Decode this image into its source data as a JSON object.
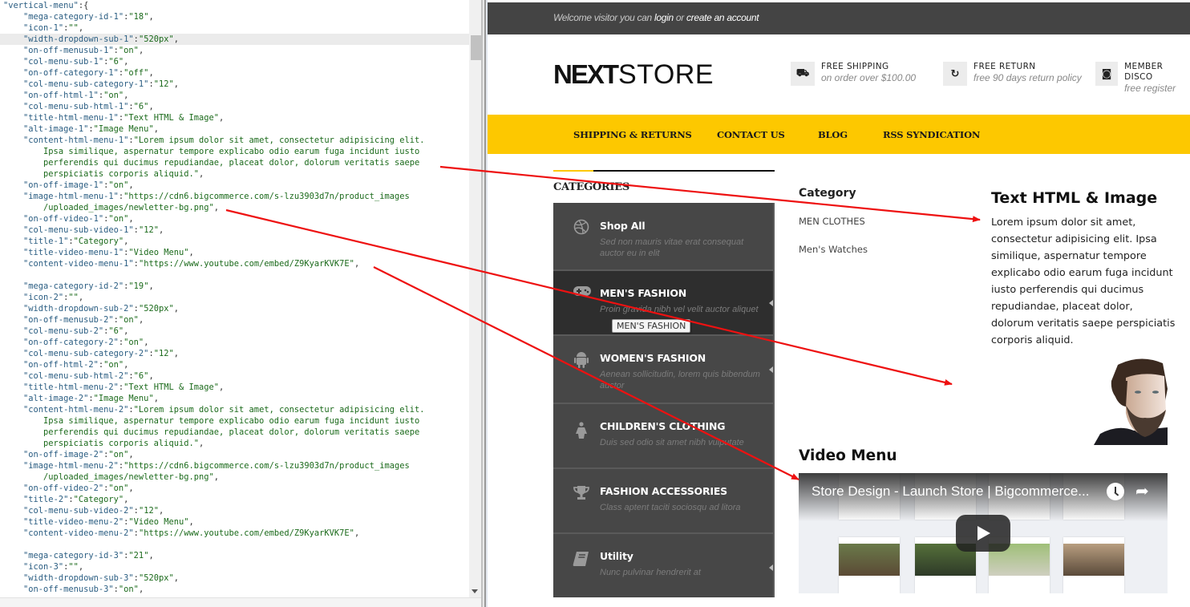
{
  "editor": {
    "lines": [
      {
        "indent": 0,
        "key": "vertical-menu",
        "value": null,
        "suffix": ":{"
      },
      {
        "indent": 1,
        "key": "mega-category-id-1",
        "value": "18",
        "suffix": ","
      },
      {
        "indent": 1,
        "key": "icon-1",
        "value": "",
        "suffix": ","
      },
      {
        "indent": 1,
        "key": "width-dropdown-sub-1",
        "value": "520px",
        "suffix": ",",
        "highlighted": true
      },
      {
        "indent": 1,
        "key": "on-off-menusub-1",
        "value": "on",
        "suffix": ","
      },
      {
        "indent": 1,
        "key": "col-menu-sub-1",
        "value": "6",
        "suffix": ","
      },
      {
        "indent": 1,
        "key": "on-off-category-1",
        "value": "off",
        "suffix": ","
      },
      {
        "indent": 1,
        "key": "col-menu-sub-category-1",
        "value": "12",
        "suffix": ","
      },
      {
        "indent": 1,
        "key": "on-off-html-1",
        "value": "on",
        "suffix": ","
      },
      {
        "indent": 1,
        "key": "col-menu-sub-html-1",
        "value": "6",
        "suffix": ","
      },
      {
        "indent": 1,
        "key": "title-html-menu-1",
        "value": "Text HTML & Image",
        "suffix": ","
      },
      {
        "indent": 1,
        "key": "alt-image-1",
        "value": "Image Menu",
        "suffix": ","
      },
      {
        "indent": 1,
        "key": "content-html-menu-1",
        "value_open": "Lorem ipsum dolor sit amet, consectetur adipisicing elit."
      },
      {
        "indent": 2,
        "cont": "Ipsa similique, aspernatur tempore explicabo odio earum fuga incidunt iusto"
      },
      {
        "indent": 2,
        "cont": "perferendis qui ducimus repudiandae, placeat dolor, dolorum veritatis saepe"
      },
      {
        "indent": 2,
        "cont_close": "perspiciatis corporis aliquid.",
        "suffix": ","
      },
      {
        "indent": 1,
        "key": "on-off-image-1",
        "value": "on",
        "suffix": ","
      },
      {
        "indent": 1,
        "key": "image-html-menu-1",
        "value_open": "https://cdn6.bigcommerce.com/s-lzu3903d7n/product_images"
      },
      {
        "indent": 2,
        "cont_close": "/uploaded_images/newletter-bg.png",
        "suffix": ","
      },
      {
        "indent": 1,
        "key": "on-off-video-1",
        "value": "on",
        "suffix": ","
      },
      {
        "indent": 1,
        "key": "col-menu-sub-video-1",
        "value": "12",
        "suffix": ","
      },
      {
        "indent": 1,
        "key": "title-1",
        "value": "Category",
        "suffix": ","
      },
      {
        "indent": 1,
        "key": "title-video-menu-1",
        "value": "Video Menu",
        "suffix": ","
      },
      {
        "indent": 1,
        "key": "content-video-menu-1",
        "value": "https://www.youtube.com/embed/Z9KyarKVK7E",
        "suffix": ","
      },
      {
        "indent": 0,
        "blank": true
      },
      {
        "indent": 1,
        "key": "mega-category-id-2",
        "value": "19",
        "suffix": ","
      },
      {
        "indent": 1,
        "key": "icon-2",
        "value": "",
        "suffix": ","
      },
      {
        "indent": 1,
        "key": "width-dropdown-sub-2",
        "value": "520px",
        "suffix": ","
      },
      {
        "indent": 1,
        "key": "on-off-menusub-2",
        "value": "on",
        "suffix": ","
      },
      {
        "indent": 1,
        "key": "col-menu-sub-2",
        "value": "6",
        "suffix": ","
      },
      {
        "indent": 1,
        "key": "on-off-category-2",
        "value": "on",
        "suffix": ","
      },
      {
        "indent": 1,
        "key": "col-menu-sub-category-2",
        "value": "12",
        "suffix": ","
      },
      {
        "indent": 1,
        "key": "on-off-html-2",
        "value": "on",
        "suffix": ","
      },
      {
        "indent": 1,
        "key": "col-menu-sub-html-2",
        "value": "6",
        "suffix": ","
      },
      {
        "indent": 1,
        "key": "title-html-menu-2",
        "value": "Text HTML & Image",
        "suffix": ","
      },
      {
        "indent": 1,
        "key": "alt-image-2",
        "value": "Image Menu",
        "suffix": ","
      },
      {
        "indent": 1,
        "key": "content-html-menu-2",
        "value_open": "Lorem ipsum dolor sit amet, consectetur adipisicing elit."
      },
      {
        "indent": 2,
        "cont": "Ipsa similique, aspernatur tempore explicabo odio earum fuga incidunt iusto"
      },
      {
        "indent": 2,
        "cont": "perferendis qui ducimus repudiandae, placeat dolor, dolorum veritatis saepe"
      },
      {
        "indent": 2,
        "cont_close": "perspiciatis corporis aliquid.",
        "suffix": ","
      },
      {
        "indent": 1,
        "key": "on-off-image-2",
        "value": "on",
        "suffix": ","
      },
      {
        "indent": 1,
        "key": "image-html-menu-2",
        "value_open": "https://cdn6.bigcommerce.com/s-lzu3903d7n/product_images"
      },
      {
        "indent": 2,
        "cont_close": "/uploaded_images/newletter-bg.png",
        "suffix": ","
      },
      {
        "indent": 1,
        "key": "on-off-video-2",
        "value": "on",
        "suffix": ","
      },
      {
        "indent": 1,
        "key": "title-2",
        "value": "Category",
        "suffix": ","
      },
      {
        "indent": 1,
        "key": "col-menu-sub-video-2",
        "value": "12",
        "suffix": ","
      },
      {
        "indent": 1,
        "key": "title-video-menu-2",
        "value": "Video Menu",
        "suffix": ","
      },
      {
        "indent": 1,
        "key": "content-video-menu-2",
        "value": "https://www.youtube.com/embed/Z9KyarKVK7E",
        "suffix": ","
      },
      {
        "indent": 0,
        "blank": true
      },
      {
        "indent": 1,
        "key": "mega-category-id-3",
        "value": "21",
        "suffix": ","
      },
      {
        "indent": 1,
        "key": "icon-3",
        "value": "",
        "suffix": ","
      },
      {
        "indent": 1,
        "key": "width-dropdown-sub-3",
        "value": "520px",
        "suffix": ","
      },
      {
        "indent": 1,
        "key": "on-off-menusub-3",
        "value": "on",
        "suffix": ","
      }
    ]
  },
  "site": {
    "topbar": {
      "welcome_prefix": "Welcome visitor you can ",
      "login_label": "login",
      "or_label": " or ",
      "create_account_label": "create an account"
    },
    "logo": {
      "part1": "NE",
      "part2": "X",
      "part3": "T",
      "part4": "STORE",
      "accent_color": "#f9c400"
    },
    "features": [
      {
        "icon": "truck-icon",
        "glyph": "⛟",
        "title": "FREE SHIPPING",
        "subtitle": "on order over $100.00"
      },
      {
        "icon": "refresh-icon",
        "glyph": "↻",
        "title": "FREE RETURN",
        "subtitle": "free 90 days return policy"
      },
      {
        "icon": "money-icon",
        "glyph": "◙",
        "title": "MEMBER DISCO",
        "subtitle": "free register"
      }
    ],
    "nav": [
      "SHIPPING & RETURNS",
      "CONTACT US",
      "BLOG",
      "RSS SYNDICATION"
    ],
    "nav_color": "#fdc800",
    "categories_heading": "CATEGORIES",
    "categories": [
      {
        "icon": "dribbble-icon",
        "glyph": "◍",
        "name": "Shop All",
        "desc": "Sed non mauris vitae erat consequat auctor eu in elit",
        "caret": false
      },
      {
        "icon": "gamepad-icon",
        "glyph": "🎮",
        "name": "MEN'S FASHION",
        "desc": "Proin gravida nibh vel velit auctor aliquet",
        "caret": true,
        "active": true
      },
      {
        "icon": "android-icon",
        "glyph": "🤖",
        "name": "WOMEN'S FASHION",
        "desc": "Aenean sollicitudin, lorem quis bibendum auctor",
        "caret": true
      },
      {
        "icon": "female-icon",
        "glyph": "🚺",
        "name": "CHILDREN'S CLOTHING",
        "desc": "Duis sed odio sit amet nibh vulputate",
        "caret": false
      },
      {
        "icon": "trophy-icon",
        "glyph": "🏆",
        "name": "FASHION ACCESSORIES",
        "desc": "Class aptent taciti sociosqu ad litora",
        "caret": false
      },
      {
        "icon": "book-icon",
        "glyph": "📘",
        "name": "Utility",
        "desc": "Nunc pulvinar hendrerit at",
        "caret": true
      }
    ],
    "tooltip": "MEN'S FASHION",
    "mega": {
      "category_title": "Category",
      "links": [
        "MEN CLOTHES",
        "Men's Watches"
      ],
      "html_title": "Text HTML & Image",
      "html_body": "Lorem ipsum dolor sit amet, consectetur adipisicing elit. Ipsa similique, aspernatur tempore explicabo odio earum fuga incidunt iusto perferendis qui ducimus repudiandae, placeat dolor, dolorum veritatis saepe perspiciatis corporis aliquid.",
      "image_alt": "Image Menu",
      "video_title": "Video Menu",
      "video_caption": "Store Design - Launch Store | Bigcommerce..."
    }
  },
  "annotation_color": "#ee1111"
}
